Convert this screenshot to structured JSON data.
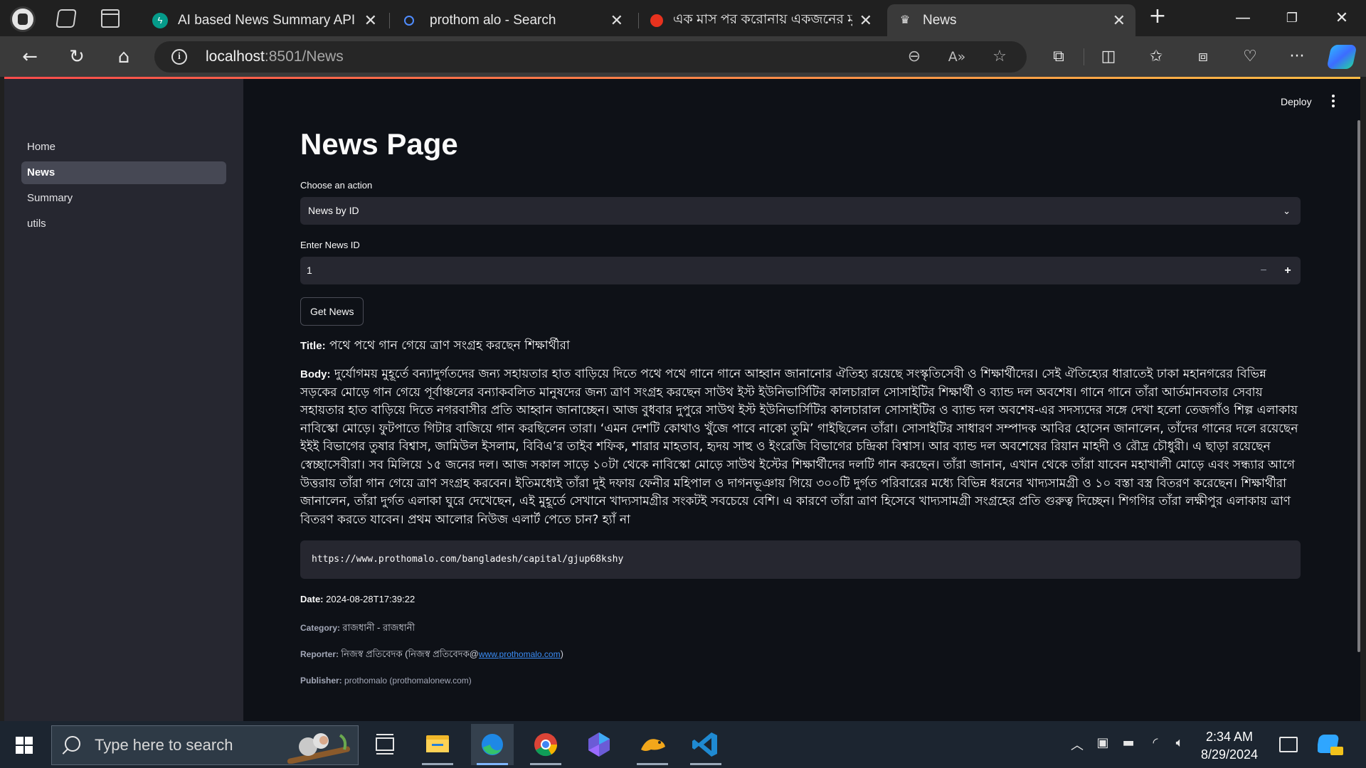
{
  "browser": {
    "tabs": [
      {
        "title": "AI based News Summary API - Sv",
        "favicon": "fastapi-icon",
        "active": false
      },
      {
        "title": "prothom alo - Search",
        "favicon": "search-icon",
        "active": false
      },
      {
        "title": "এক মাস পর করোনায় একজনের মৃ",
        "favicon": "prothomalo-sun-icon",
        "active": false
      },
      {
        "title": "News",
        "favicon": "streamlit-crown-icon",
        "active": true
      }
    ],
    "address": {
      "host": "localhost",
      "path": ":8501/News"
    },
    "colors": {
      "tabstrip": "#202020",
      "toolbar": "#3a3a3a"
    }
  },
  "app": {
    "deploy_label": "Deploy",
    "sidebar": {
      "items": [
        {
          "label": "Home",
          "active": false
        },
        {
          "label": "News",
          "active": true
        },
        {
          "label": "Summary",
          "active": false
        },
        {
          "label": "utils",
          "active": false
        }
      ]
    },
    "page_title": "News Page",
    "action_label": "Choose an action",
    "action_value": "News by ID",
    "newsid_label": "Enter News ID",
    "newsid_value": "1",
    "get_news_label": "Get News",
    "news": {
      "title_key": "Title:",
      "title": "পথে পথে গান গেয়ে ত্রাণ সংগ্রহ করছেন শিক্ষার্থীরা",
      "body_key": "Body:",
      "body": "দুর্যোগময় মুহূর্তে বন্যাদুর্গতদের জন্য সহায়তার হাত বাড়িয়ে দিতে পথে পথে গানে গানে আহ্বান জানানোর ঐতিহ্য রয়েছে সংস্কৃতিসেবী ও শিক্ষার্থীদের। সেই ঐতিহ্যের ধারাতেই ঢাকা মহানগরের বিভিন্ন সড়কের মোড়ে গান গেয়ে পূর্বাঞ্চলের বন্যাকবলিত মানুষদের জন্য ত্রাণ সংগ্রহ করছেন সাউথ ইস্ট ইউনিভার্সিটির কালচারাল সোসাইটির শিক্ষার্থী ও ব্যান্ড দল অবশেষ। গানে গানে তাঁরা আর্তমানবতার সেবায় সহায়তার হাত বাড়িয়ে দিতে নগরবাসীর প্রতি আহ্বান জানাচ্ছেন। আজ বুধবার দুপুরে সাউথ ইস্ট ইউনিভার্সিটির কালচারাল সোসাইটির ও ব্যান্ড দল অবশেষ-এর সদস্যদের সঙ্গে দেখা হলো তেজগাঁও শিল্প এলাকায় নাবিস্কো মোড়ে। ফুটপাতে গিটার বাজিয়ে গান করছিলেন তারা। ‘এমন দেশটি কোথাও খুঁজে পাবে নাকো তুমি’ গাইছিলেন তাঁরা। সোসাইটির সাধারণ সম্পাদক আবির হোসেন জানালেন, তাঁদের গানের দলে রয়েছেন ইইই বিভাগের তুষার বিশ্বাস, জামিউল ইসলাম, বিবিএ’র তাইব শফিক, শারার মাহতাব, হৃদয় সাহু ও ইংরেজি বিভাগের চন্দ্রিকা বিশ্বাস। আর ব্যান্ড দল অবশেষের রিয়ান মাহদী ও রৌদ্র চৌধুরী। এ ছাড়া রয়েছেন স্বেচ্ছাসেবীরা। সব মিলিয়ে ১৫ জনের দল। আজ সকাল সাড়ে ১০টা থেকে নাবিস্কো মোড়ে সাউথ ইস্টের শিক্ষার্থীদের দলটি গান করছেন। তাঁরা জানান, এখান থেকে তাঁরা যাবেন মহাখালী মোড়ে এবং সন্ধ্যার আগে উত্তরায় তাঁরা গান গেয়ে ত্রাণ সংগ্রহ করবেন। ইতিমধ্যেই তাঁরা দুই দফায় ফেনীর মহিপাল ও দাগনভূঞায় গিয়ে ৩০০টি দুর্গত পরিবারের মধ্যে বিভিন্ন ধরনের খাদ্যসামগ্রী ও ১০ বস্তা বস্ত্র বিতরণ করেছেন। শিক্ষার্থীরা জানালেন, তাঁরা দুর্গত এলাকা ঘুরে দেখেছেন, এই মুহূর্তে সেখানে খাদ্যসামগ্রীর সংকটই সবচেয়ে বেশি। এ কারণে তাঁরা ত্রাণ হিসেবে খাদ্যসামগ্রী সংগ্রহের প্রতি গুরুত্ব দিচ্ছেন। শিগগির তাঁরা লক্ষীপুর এলাকায় ত্রাণ বিতরণ করতে যাবেন। প্রথম আলোর নিউজ এলার্ট পেতে চান? হ্যাঁ না",
      "url": "https://www.prothomalo.com/bangladesh/capital/gjup68kshy",
      "date_key": "Date:",
      "date": "2024-08-28T17:39:22",
      "category_key": "Category:",
      "category": "রাজধানী - রাজধানী",
      "reporter_key": "Reporter:",
      "reporter_prefix": "নিজস্ব প্রতিবেদক (নিজস্ব প্রতিবেদক@",
      "reporter_link": "www.prothomalo.com",
      "reporter_suffix": ")",
      "publisher_key": "Publisher:",
      "publisher": "prothomalo (prothomalonew.com)"
    },
    "colors": {
      "background": "#0e1117",
      "sidebar": "#262730",
      "widget": "#262730",
      "link": "#3b8df5"
    }
  },
  "taskbar": {
    "search_placeholder": "Type here to search",
    "apps": [
      "task-view-icon",
      "file-explorer-icon",
      "edge-icon",
      "chrome-icon",
      "copilot-app-icon",
      "ferret-app-icon",
      "vscode-icon"
    ],
    "clock_time": "2:34 AM",
    "clock_date": "8/29/2024"
  }
}
